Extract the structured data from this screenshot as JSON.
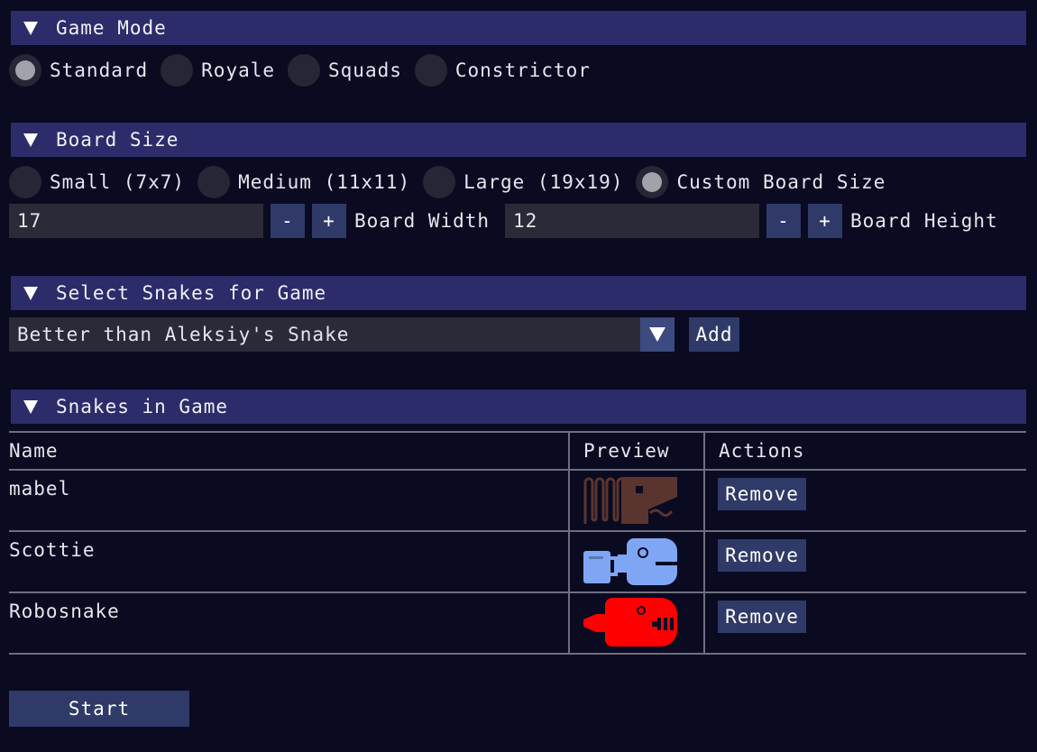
{
  "game_mode": {
    "title": "Game Mode",
    "options": [
      "Standard",
      "Royale",
      "Squads",
      "Constrictor"
    ],
    "selected": "Standard"
  },
  "board_size": {
    "title": "Board Size",
    "options": [
      "Small (7x7)",
      "Medium (11x11)",
      "Large (19x19)",
      "Custom Board Size"
    ],
    "selected": "Custom Board Size",
    "width_value": "17",
    "width_label": "Board Width",
    "height_value": "12",
    "height_label": "Board Height",
    "minus": "-",
    "plus": "+"
  },
  "select_snakes": {
    "title": "Select Snakes for Game",
    "selected_snake": "Better than Aleksiy's Snake",
    "add_label": "Add"
  },
  "snakes_in_game": {
    "title": "Snakes in Game",
    "columns": [
      "Name",
      "Preview",
      "Actions"
    ],
    "rows": [
      {
        "name": "mabel",
        "color": "#5a3530",
        "action": "Remove"
      },
      {
        "name": "Scottie",
        "color": "#7fa6f5",
        "action": "Remove"
      },
      {
        "name": "Robosnake",
        "color": "#ff0000",
        "action": "Remove"
      }
    ]
  },
  "start_label": "Start",
  "colors": {
    "background": "#0a0a21",
    "header": "#2c2c6b",
    "button": "#2f3a68"
  }
}
